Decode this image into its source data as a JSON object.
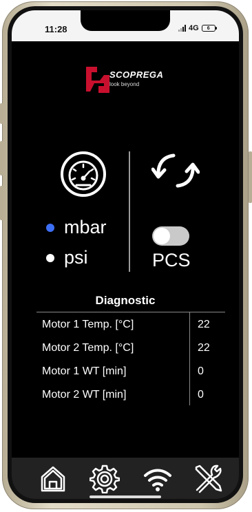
{
  "status": {
    "time": "11:28",
    "network": "4G",
    "battery": "6"
  },
  "brand": {
    "name": "SCOPREGA",
    "tagline": "look beyond",
    "colors": {
      "primary": "#c8102e",
      "text": "#ffffff"
    }
  },
  "pressure_units": {
    "options": [
      {
        "label": "mbar",
        "selected": true
      },
      {
        "label": "psi",
        "selected": false
      }
    ],
    "colors": {
      "selected": "#3d6ff5",
      "unselected": "#ffffff"
    }
  },
  "pcs": {
    "label": "PCS",
    "enabled": false
  },
  "diagnostic": {
    "title": "Diagnostic",
    "rows": [
      {
        "label": "Motor 1 Temp. [°C]",
        "value": "22"
      },
      {
        "label": "Motor 2 Temp. [°C]",
        "value": "22"
      },
      {
        "label": "Motor 1 WT [min]",
        "value": "0"
      },
      {
        "label": "Motor 2 WT [min]",
        "value": "0"
      }
    ]
  },
  "nav": {
    "items": [
      {
        "name": "home",
        "icon": "home-icon"
      },
      {
        "name": "settings",
        "icon": "gear-icon"
      },
      {
        "name": "wifi",
        "icon": "wifi-icon"
      },
      {
        "name": "tools",
        "icon": "tools-icon"
      }
    ]
  }
}
